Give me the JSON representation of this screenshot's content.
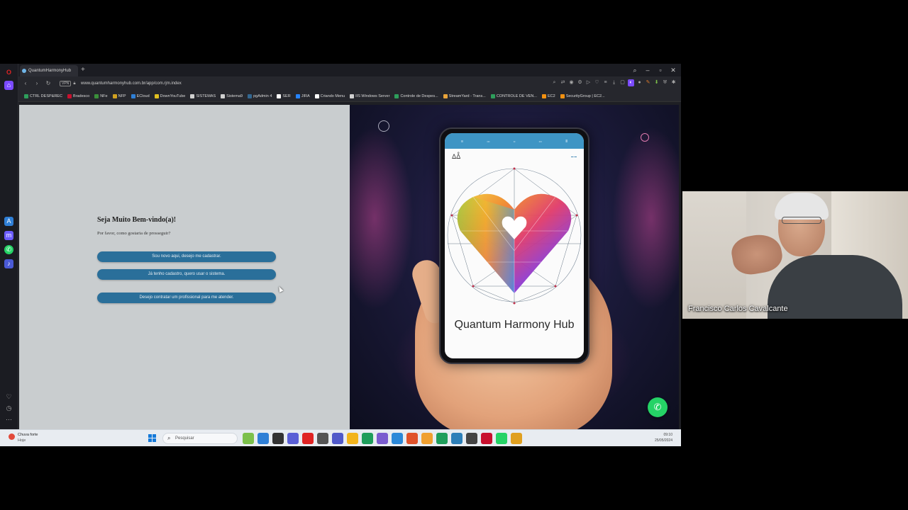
{
  "browser": {
    "tab_title": "QuantumHarmonyHub",
    "url": "www.quantumharmonyhub.com.br/app/com.rjm.index",
    "vpn_label": "VPN",
    "bookmarks": [
      {
        "label": "CTRL DESP&REC",
        "color": "#2e9e5b"
      },
      {
        "label": "Bradesco",
        "color": "#c8102e"
      },
      {
        "label": "NFe",
        "color": "#3a8f3a"
      },
      {
        "label": "NFP",
        "color": "#d0a020"
      },
      {
        "label": "ECloud",
        "color": "#2f7fd6"
      },
      {
        "label": "DownYouTube",
        "color": "#e0c020"
      },
      {
        "label": "SISTEMAS",
        "color": "#cfcfcf"
      },
      {
        "label": "Sistema9",
        "color": "#cfcfcf"
      },
      {
        "label": "pgAdmin 4",
        "color": "#336791"
      },
      {
        "label": "SER",
        "color": "#ffffff"
      },
      {
        "label": "JIRA",
        "color": "#2684ff"
      },
      {
        "label": "Criando Menu",
        "color": "#ffffff"
      },
      {
        "label": "IIS Windows Server",
        "color": "#cfcfcf"
      },
      {
        "label": "Controle de Despes...",
        "color": "#2e9e5b"
      },
      {
        "label": "StreamYard - Trans...",
        "color": "#e8a33a"
      },
      {
        "label": "CONTROLE DE VEN...",
        "color": "#2e9e5b"
      },
      {
        "label": "EC2",
        "color": "#f29111"
      },
      {
        "label": "SecurityGroup | EC2...",
        "color": "#f29111"
      }
    ]
  },
  "welcome": {
    "title": "Seja Muito Bem-vindo(a)!",
    "subtitle": "Por favor, como gostaria de prosseguir?",
    "btn_register": "Sou novo aqui, desejo me cadastrar.",
    "btn_login": "Já tenho cadastro, quero usar o sistema.",
    "btn_hire": "Desejo contratar um profissional para me atender."
  },
  "hero": {
    "app_name": "Quantum Harmony Hub"
  },
  "taskbar": {
    "weather_line1": "Chuva forte",
    "weather_line2": "Hoje",
    "search_placeholder": "Pesquisar",
    "time": "09:10",
    "date": "25/05/2024",
    "apps": [
      "#7cc04b",
      "#2f7fd6",
      "#333333",
      "#5a5fd6",
      "#e02424",
      "#555555",
      "#5059c9",
      "#f2b41c",
      "#1f9e5b",
      "#7a5ccf",
      "#2b88d8",
      "#e0532b",
      "#f0a030",
      "#1f9e5b",
      "#2d7fb8",
      "#444444",
      "#c8102e",
      "#25d366",
      "#e0a020"
    ]
  },
  "webcam": {
    "name": "Francisco Carlos Cavalcante"
  },
  "colors": {
    "accent_button": "#2a6f9a",
    "whatsapp": "#25d366"
  }
}
